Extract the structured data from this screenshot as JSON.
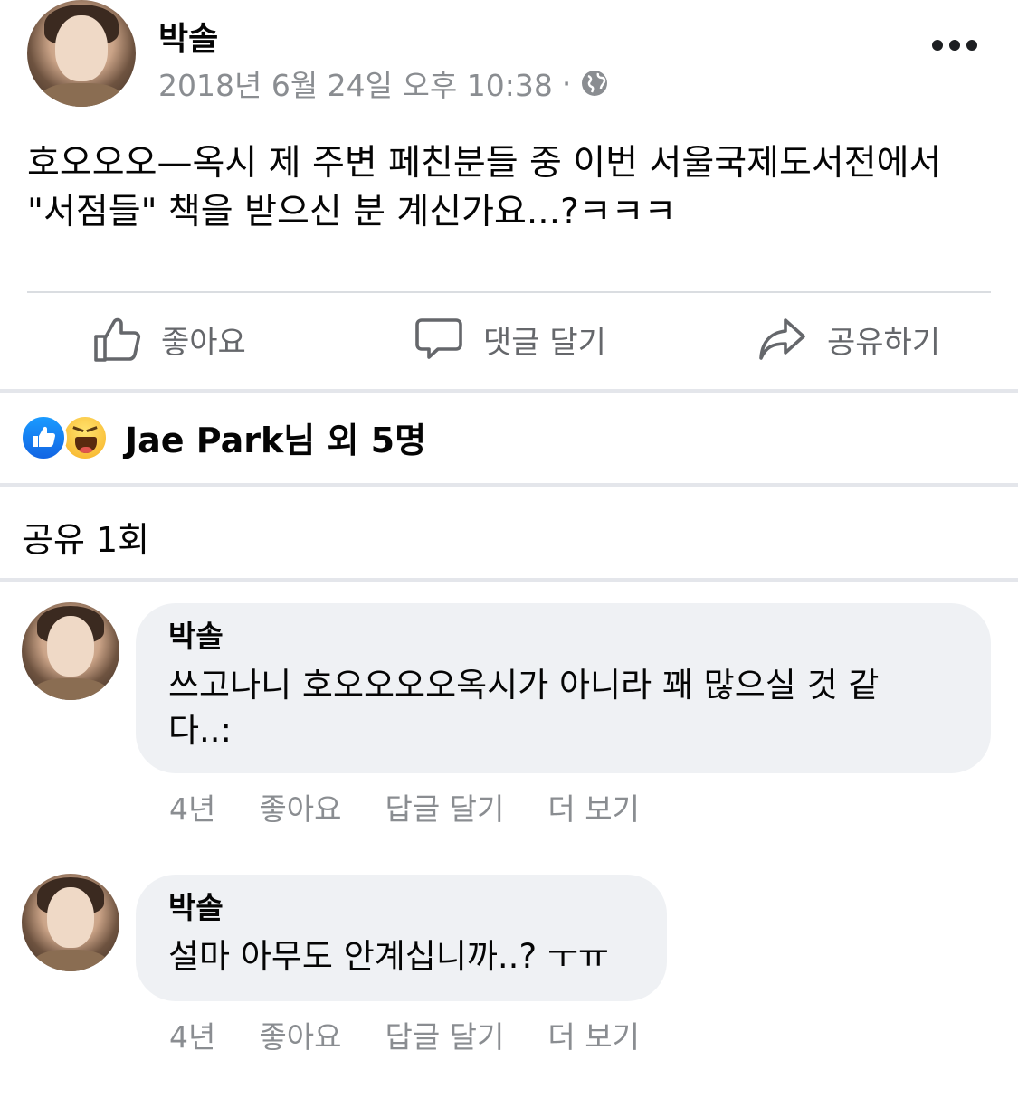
{
  "post": {
    "author": "박솔",
    "timestamp": "2018년 6월 24일 오후 10:38",
    "meta_separator": "·",
    "privacy_icon": "globe-icon",
    "more_icon": "more-options-icon",
    "body_line1": "호오오오—옥시 제 주변 페친분들 중 이번 서울국제도서전에서",
    "body_line2": "\"서점들\" 책을 받으신 분 계신가요...?ㅋㅋㅋ"
  },
  "actions": {
    "like_label": "좋아요",
    "comment_label": "댓글 달기",
    "share_label": "공유하기"
  },
  "reactions": {
    "icons": [
      "like-reaction-icon",
      "haha-reaction-icon"
    ],
    "summary": "Jae Park님 외 5명"
  },
  "shares": {
    "label": "공유 1회"
  },
  "comments": [
    {
      "author": "박솔",
      "line1": "쓰고나니 호오오오오옥시가 아니라 꽤 많으실 것 같",
      "line2": "다..:",
      "age": "4년",
      "like_label": "좋아요",
      "reply_label": "답글 달기",
      "more_label": "더 보기"
    },
    {
      "author": "박솔",
      "line1": "설마 아무도 안계십니까..? ㅜㅠ",
      "age": "4년",
      "like_label": "좋아요",
      "reply_label": "답글 달기",
      "more_label": "더 보기"
    }
  ],
  "colors": {
    "secondary_text": "#65676b",
    "meta_text": "#8a8d91",
    "bubble_bg": "#eff1f4",
    "like_blue": "#1877f2",
    "divider": "#e4e6eb"
  }
}
